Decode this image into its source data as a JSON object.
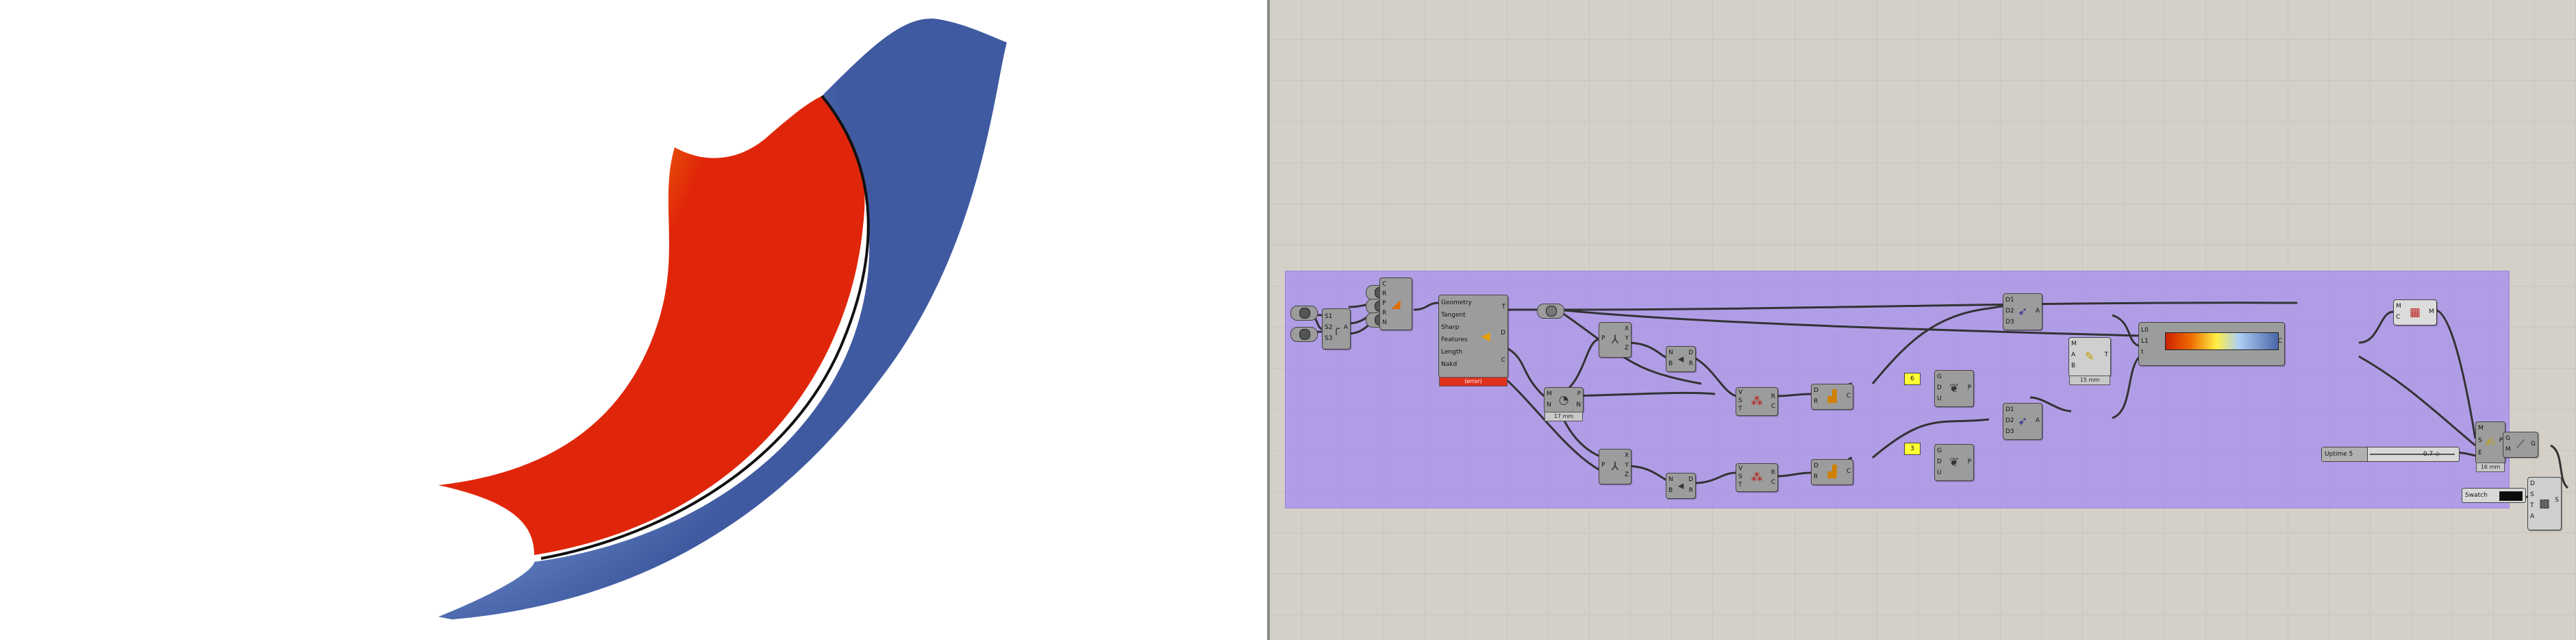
{
  "colors": {
    "group_fill": "#a68eee",
    "canvas_bg": "#d4d0c8",
    "component": "#9c9c9c",
    "error": "#e0301e",
    "highlight": "#ffff33",
    "gradient_stops": [
      "#cc2200",
      "#ee6a00",
      "#ffee44",
      "#aecff5",
      "#4a66aa"
    ]
  },
  "viewport": {
    "name": "rhino-viewport",
    "geometry": "colored-surface"
  },
  "canvas": {
    "components": {
      "pt1": {
        "icon": "point-icon"
      },
      "pt2": {
        "icon": "point-icon"
      },
      "pt3": {
        "icon": "point-icon"
      },
      "pt4": {
        "icon": "point-icon"
      },
      "pt5": {
        "icon": "point-icon"
      },
      "arc3pt": {
        "inputs": [
          "S1",
          "S2",
          "S3"
        ],
        "output": "A",
        "icon": "arc-icon"
      },
      "loft": {
        "inputs": [
          "C",
          "R",
          "P",
          "R",
          "N"
        ],
        "icon": "loft-icon"
      },
      "offset": {
        "inputs": [
          "Geometry",
          "Tangent",
          "Sharp",
          "Features",
          "Length",
          "Nakd"
        ],
        "outputs": [
          "T",
          "D",
          "C"
        ],
        "status": "(error)",
        "icon": "offset-icon"
      },
      "hexparam": {
        "icon": "hexagon-icon"
      },
      "divide": {
        "inputs": [
          "M",
          "N"
        ],
        "outputs": [
          "P",
          "N"
        ],
        "status": "17 mm",
        "icon": "divide-icon"
      },
      "deconst1": {
        "inputs": [
          "P"
        ],
        "outputs": [
          "X",
          "Y",
          "Z"
        ],
        "icon": "deconstruct-icon"
      },
      "deconst2": {
        "inputs": [
          "P"
        ],
        "outputs": [
          "X",
          "Y",
          "Z"
        ],
        "icon": "deconstruct-icon"
      },
      "bounds1": {
        "inputs": [
          "N",
          "B"
        ],
        "outputs": [
          "D",
          "R"
        ],
        "icon": "bounds-icon"
      },
      "bounds2": {
        "inputs": [
          "N",
          "B"
        ],
        "outputs": [
          "D",
          "R"
        ],
        "icon": "bounds-icon"
      },
      "remap1": {
        "inputs": [
          "V",
          "S",
          "T"
        ],
        "outputs": [
          "R",
          "C"
        ],
        "icon": "remap-icon"
      },
      "remap2": {
        "inputs": [
          "V",
          "S",
          "T"
        ],
        "outputs": [
          "R",
          "C"
        ],
        "icon": "remap-icon"
      },
      "graph1": {
        "inputs": [
          "D",
          "R"
        ],
        "outputs": [
          "C"
        ],
        "icon": "graph-icon"
      },
      "graph2": {
        "inputs": [
          "D",
          "R"
        ],
        "outputs": [
          "C"
        ],
        "icon": "graph-icon"
      },
      "yellow1": {
        "label": "6"
      },
      "yellow2": {
        "label": "3"
      },
      "sample1": {
        "inputs": [
          "G",
          "D",
          "U"
        ],
        "outputs": [
          "P"
        ],
        "icon": "sample-icon"
      },
      "sample2": {
        "inputs": [
          "G",
          "D",
          "U"
        ],
        "outputs": [
          "P"
        ],
        "icon": "sample-icon"
      },
      "crv1": {
        "inputs": [
          "D1",
          "D2",
          "D3"
        ],
        "outputs": [
          "A"
        ],
        "icon": "curve-icon"
      },
      "crv2": {
        "inputs": [
          "D1",
          "D2",
          "D3"
        ],
        "outputs": [
          "A"
        ],
        "icon": "curve-icon"
      },
      "evalc": {
        "inputs": [
          "M",
          "A",
          "B"
        ],
        "outputs": [
          "T"
        ],
        "status": "15 mm",
        "icon": "evaluate-icon"
      },
      "gradient": {
        "inputs": [
          "L0",
          "L1",
          "t"
        ],
        "outputs": [
          "C"
        ],
        "icon": "gradient-icon"
      },
      "mesh": {
        "inputs": [
          "M",
          "C"
        ],
        "outputs": [
          "M"
        ],
        "icon": "mesh-colour-icon"
      },
      "preview": {
        "inputs": [
          "G",
          "M"
        ],
        "outputs": [
          "G"
        ],
        "icon": "custom-preview-icon"
      },
      "bounds3": {
        "inputs": [
          "M",
          "S",
          "E"
        ],
        "outputs": [
          "P"
        ],
        "status": "16 mm",
        "icon": "blend-icon"
      },
      "shader": {
        "inputs": [
          "D",
          "S",
          "T",
          "A"
        ],
        "outputs": [
          "S"
        ],
        "icon": "shader-icon"
      }
    },
    "slider": {
      "name": "Uptime 5",
      "value": "0.7 ◇"
    },
    "swatch": {
      "name": "Swatch"
    }
  }
}
